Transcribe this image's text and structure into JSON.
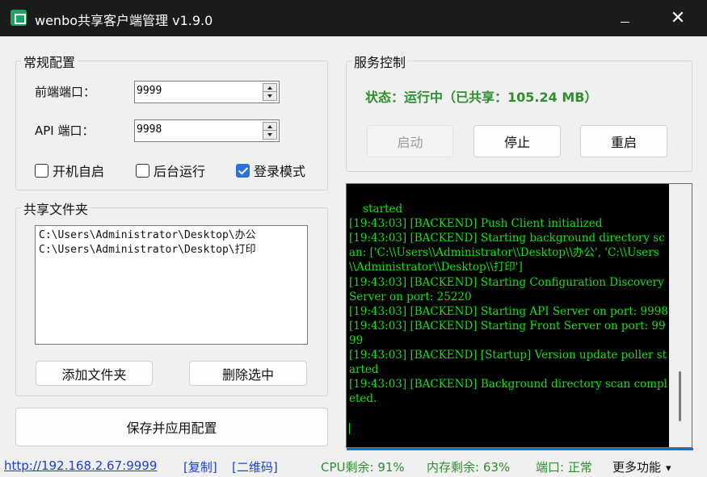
{
  "window": {
    "title": "wenbo共享客户端管理 v1.9.0",
    "minimize_glyph": "—",
    "close_glyph": "✕"
  },
  "general": {
    "group_label": "常规配置",
    "frontend_port_label": "前端端口：",
    "frontend_port_value": "9999",
    "api_port_label": "API 端口：",
    "api_port_value": "9998",
    "checkboxes": [
      {
        "label": "开机自启",
        "checked": false
      },
      {
        "label": "后台运行",
        "checked": false
      },
      {
        "label": "登录模式",
        "checked": true
      }
    ]
  },
  "shared": {
    "group_label": "共享文件夹",
    "folders": [
      "C:\\Users\\Administrator\\Desktop\\办公",
      "C:\\Users\\Administrator\\Desktop\\打印"
    ],
    "add_button": "添加文件夹",
    "remove_button": "删除选中"
  },
  "save_button": "保存并应用配置",
  "service": {
    "group_label": "服务控制",
    "status_text": "状态：运行中（已共享：105.24 MB）",
    "start_button": "启动",
    "stop_button": "停止",
    "restart_button": "重启",
    "start_enabled": false
  },
  "console": {
    "log": "started\n[19:43:03] [BACKEND] Push Client initialized\n[19:43:03] [BACKEND] Starting background directory scan: ['C:\\\\Users\\\\Administrator\\\\Desktop\\\\办公', 'C:\\\\Users\\\\Administrator\\\\Desktop\\\\打印']\n[19:43:03] [BACKEND] Starting Configuration Discovery Server on port: 25220\n[19:43:03] [BACKEND] Starting API Server on port: 9998\n[19:43:03] [BACKEND] Starting Front Server on port: 9999\n[19:43:03] [BACKEND] [Startup] Version update poller started\n[19:43:03] [BACKEND] Background directory scan completed."
  },
  "statusbar": {
    "url": "http://192.168.2.67:9999",
    "copy_link": "[复制]",
    "qrcode_link": "[二维码]",
    "cpu": "CPU剩余: 91%",
    "memory": "内存剩余: 63%",
    "port_status": "端口: 正常",
    "more": "更多功能"
  },
  "colors": {
    "titlebar": "#1b1b1b",
    "status_green": "#2f8f2f",
    "console_text": "#11e311",
    "link_blue": "#1a3fd6",
    "checkbox_blue": "#2a72d4"
  }
}
